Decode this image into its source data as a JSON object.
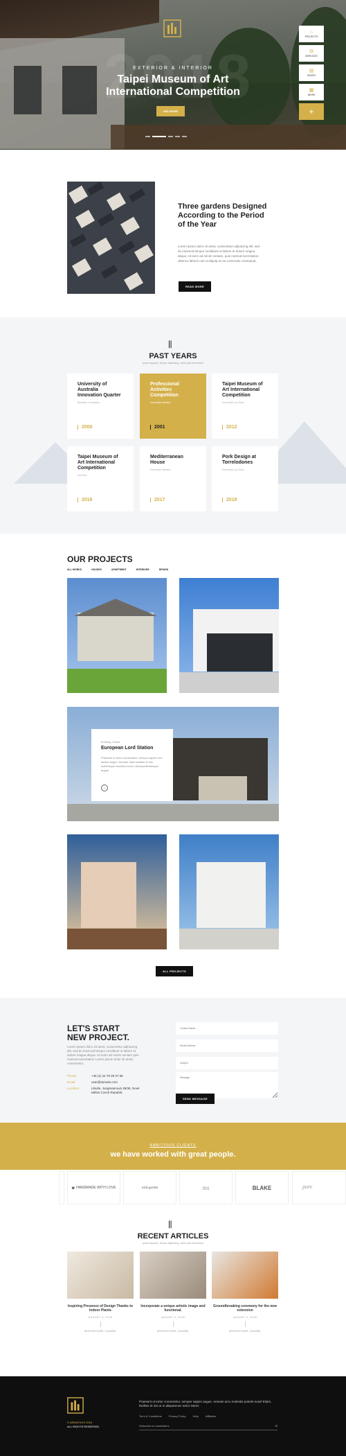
{
  "hero": {
    "eyebrow": "EXTERIOR & INTERIOR",
    "title_line1": "Taipei Museum of Art",
    "title_line2": "International Competition",
    "cta": "SEE MORE",
    "big_year": "2018",
    "side_menu": [
      {
        "label": "PROJECTS",
        "icon": "house-icon"
      },
      {
        "label": "SERVICES",
        "icon": "gear-icon"
      },
      {
        "label": "PAGES",
        "icon": "document-icon"
      },
      {
        "label": "NEWS",
        "icon": "newspaper-icon"
      }
    ],
    "plus": "+"
  },
  "about": {
    "title": "Three gardens Designed According to the Period of the Year",
    "text": "Lorem ipsum dolor sit amet, consectetur adipiscing elit, sed do eiusmod tempor incididunt ut labore et dolore magna aliqua. Ut enim ad minim veniam, quis nostrud exercitation ullamco laboris nisi ut aliquip ex ea commodo consequat.",
    "button": "READ MORE"
  },
  "years": {
    "title": "PAST YEARS",
    "subtitle": "Ipsum aliquam, tempor adipiscing, lorem quis fermentum",
    "cards": [
      {
        "title": "University of Australia Innovation Quarter",
        "sub": "Benefitis & Invitation",
        "year": "2000",
        "featured": false
      },
      {
        "title": "Professional Activities Competition",
        "sub": "Honorable Mention",
        "year": "2001",
        "featured": true
      },
      {
        "title": "Taipei Museum of Art International Competition",
        "sub": "Honorable Lux Prize",
        "year": "2012",
        "featured": false
      },
      {
        "title": "Taipei Museum of Art International Competition",
        "sub": "1st Prize",
        "year": "2016",
        "featured": false
      },
      {
        "title": "Mediterranean House",
        "sub": "Honorable Mention",
        "year": "2017",
        "featured": false
      },
      {
        "title": "Pork Design at Torrelodones",
        "sub": "Honorable Lux Prize",
        "year": "2018",
        "featured": false
      }
    ]
  },
  "projects": {
    "title": "OUR PROJECTS",
    "filters": [
      "ALL WORKS",
      "HOUSES",
      "APARTMENT",
      "INTERIORS",
      "DESIGN"
    ],
    "featured": {
      "category": "Building, Estate",
      "name": "European Lord Station",
      "desc": "Praesent ut tortor consectetur, semper sapien nec, lacinia augue. Aenean diam facilisis et nisi scelerisque faucibus lorem dictumpellentesque augue."
    },
    "button": "ALL PROJECTS"
  },
  "contact": {
    "title_line1": "LET'S START",
    "title_line2": "NEW PROJECT.",
    "text": "Lorem ipsum dolor sit amet, consectetur adipiscing elit, sed do eiusmod tempor incididunt ut labore et dolore magna aliqua. Ut enim ad minim veniam quis nostrud exercitation Lorem ipsum dolor sit amet, consectetur.",
    "phone_label": "Phone:",
    "phone": "+46 (1) 24 78 29 37 58",
    "email_label": "Email:",
    "email": "user@domain.com",
    "location_label": "Location:",
    "location": "Libuše, Jungmannova 35/36, Nové Město Czech Republic",
    "fields": {
      "name": "Contact Name",
      "email": "Email Address",
      "subject": "Subject",
      "message": "Message"
    },
    "button": "SEND MESSAGE"
  },
  "clients": {
    "eyebrow": "AMBITIOUS CLIENTS",
    "title": "we have worked with great people.",
    "logos": [
      "HANDMADE WITH LOVE",
      "wild garden",
      "ms",
      "BLAKE",
      "pure"
    ]
  },
  "articles": {
    "title": "RECENT ARTICLES",
    "subtitle": "Ipsum aliquam, tempor adipiscing, lorem quis fermentum",
    "items": [
      {
        "title": "Inspiring Presence of Design Thanks to Indoor Plants",
        "date": "AUGUST 3, 2018",
        "cat": "ARCHITECTURE, COUNSEL"
      },
      {
        "title": "Incorporate a unique artistic image and functional.",
        "date": "AUGUST 3, 2018",
        "cat": "ARCHITECTURE, COUNSEL"
      },
      {
        "title": "Groundbreaking ceremony for the new extension",
        "date": "AUGUST 3, 2018",
        "cat": "ARCHITECTURE, COUNSEL"
      }
    ]
  },
  "footer": {
    "copy_line1": "© ARMATHUS 2018",
    "copy_line2": "ALL RIGHTS RESERVED",
    "desc": "Praesent ut tortor consectetur, semper sapien augue. Aenean arcu molestie potenti eusel Etiam, facilisis et nisi ut in aliquamnec tortor interd.",
    "links": [
      "Term & Conditions",
      "Privacy Policy",
      "Help",
      "Affiliates"
    ],
    "subscribe": "Subscribe to newsletters"
  },
  "colors": {
    "accent": "#d4b04a",
    "dark": "#111111",
    "light_bg": "#f4f5f7"
  }
}
